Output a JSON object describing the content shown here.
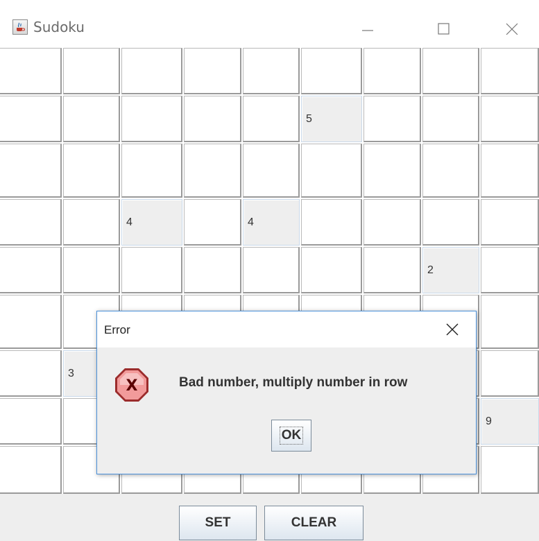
{
  "window": {
    "title": "Sudoku",
    "icon": "java-cup-icon"
  },
  "grid": {
    "rows": [
      [
        "",
        "",
        "",
        "",
        "",
        "",
        "",
        "",
        ""
      ],
      [
        "",
        "",
        "",
        "",
        "",
        "5",
        "",
        "",
        ""
      ],
      [
        "",
        "",
        "",
        "",
        "",
        "",
        "",
        "",
        ""
      ],
      [
        "",
        "",
        "4",
        "",
        "4",
        "",
        "",
        "",
        ""
      ],
      [
        "",
        "",
        "",
        "",
        "",
        "",
        "",
        "2",
        ""
      ],
      [
        "",
        "",
        "",
        "",
        "",
        "",
        "",
        "",
        ""
      ],
      [
        "",
        "3",
        "",
        "",
        "",
        "",
        "",
        "",
        ""
      ],
      [
        "",
        "",
        "",
        "",
        "",
        "",
        "",
        "",
        "9"
      ],
      [
        "",
        "",
        "",
        "",
        "",
        "",
        "",
        "",
        ""
      ]
    ]
  },
  "buttons": {
    "set": "SET",
    "clear": "CLEAR"
  },
  "dialog": {
    "title": "Error",
    "message": "Bad number, multiply number in row",
    "ok": "OK",
    "icon": "error-x-icon"
  },
  "colors": {
    "dialog_border": "#4a90d9",
    "filled_cell": "#eeeeee",
    "error_icon": "#e06666"
  }
}
